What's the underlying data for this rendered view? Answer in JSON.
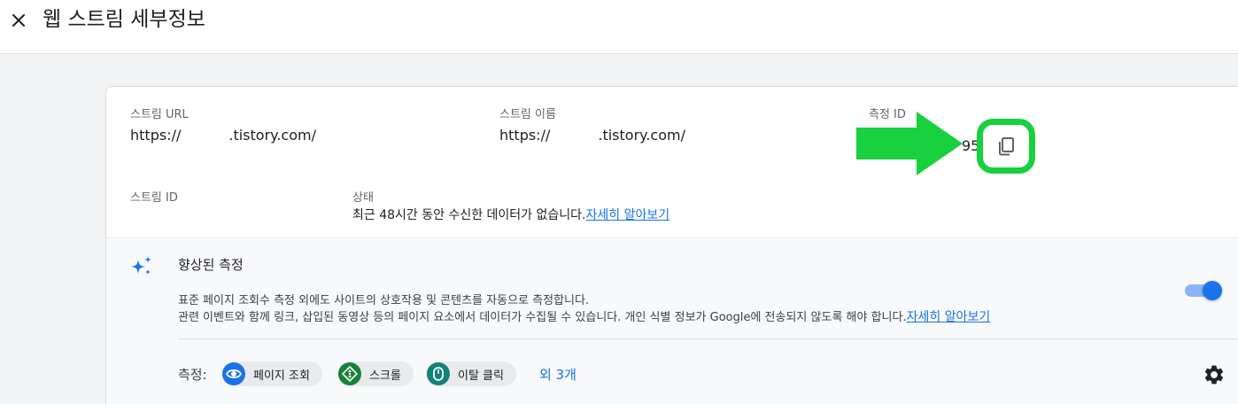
{
  "header": {
    "title": "웹 스트림 세부정보"
  },
  "stream": {
    "url_label": "스트림 URL",
    "url_prefix": "https://",
    "url_suffix": ".tistory.com/",
    "name_label": "스트림 이름",
    "name_prefix": "https://",
    "name_suffix": ".tistory.com/",
    "measurement_id_label": "측정 ID",
    "measurement_id_fragment": "95",
    "stream_id_label": "스트림 ID",
    "status_label": "상태",
    "status_text": "최근 48시간 동안 수신한 데이터가 없습니다.",
    "status_link": "자세히 알아보기"
  },
  "enhanced": {
    "title": "향상된 측정",
    "desc_line1": "표준 페이지 조회수 측정 외에도 사이트의 상호작용 및 콘텐츠를 자동으로 측정합니다.",
    "desc_line2": "관련 이벤트와 함께 링크, 삽입된 동영상 등의 페이지 요소에서 데이터가 수집될 수 있습니다. 개인 식별 정보가 Google에 전송되지 않도록 해야 합니다.",
    "desc_link": "자세히 알아보기",
    "toggle_on": true,
    "measuring_label": "측정:",
    "chips": [
      {
        "label": "페이지 조회",
        "icon": "eye-icon",
        "color": "#1a73e8"
      },
      {
        "label": "스크롤",
        "icon": "scroll-icon",
        "color": "#188038"
      },
      {
        "label": "이탈 클릭",
        "icon": "mouse-icon",
        "color": "#12827a"
      }
    ],
    "more_link": "외 3개"
  },
  "colors": {
    "accent": "#1a73e8",
    "highlight": "#19d03f"
  }
}
